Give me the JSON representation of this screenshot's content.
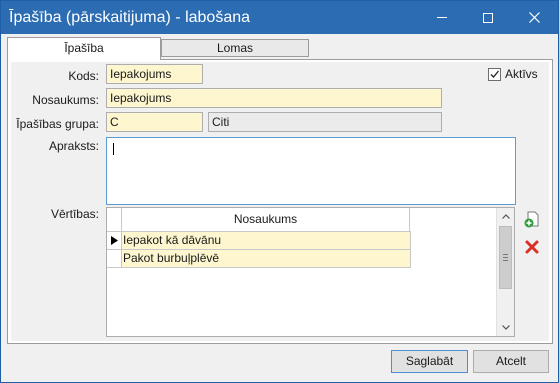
{
  "window": {
    "title": "Īpašība (pārskaitijuma) - labošana",
    "colors": {
      "titlebar": "#2b6cb3",
      "field_yellow": "#fdf6cf",
      "field_grey": "#ebebeb",
      "delete_red": "#d93025",
      "add_green": "#2e9e3a"
    }
  },
  "tabs": [
    {
      "label": "Īpašība",
      "active": true
    },
    {
      "label": "Lomas",
      "active": false
    }
  ],
  "form": {
    "code_label": "Kods:",
    "code_value": "Iepakojums",
    "name_label": "Nosaukums:",
    "name_value": "Iepakojums",
    "group_label": "Īpašības grupa:",
    "group_code": "C",
    "group_name": "Citi",
    "description_label": "Apraksts:",
    "description_value": "",
    "values_label": "Vērtības:",
    "active_label": "Aktīvs",
    "active_checked": true
  },
  "values_table": {
    "columns": [
      "Nosaukums"
    ],
    "rows": [
      {
        "name": "Iepakot kā dāvānu",
        "current": true
      },
      {
        "name": "Pakot burbuļplēvē",
        "current": false
      }
    ]
  },
  "side_actions": {
    "add_icon": "add-row-icon",
    "delete_icon": "delete-row-icon"
  },
  "footer": {
    "save_label": "Saglabāt",
    "cancel_label": "Atcelt"
  }
}
